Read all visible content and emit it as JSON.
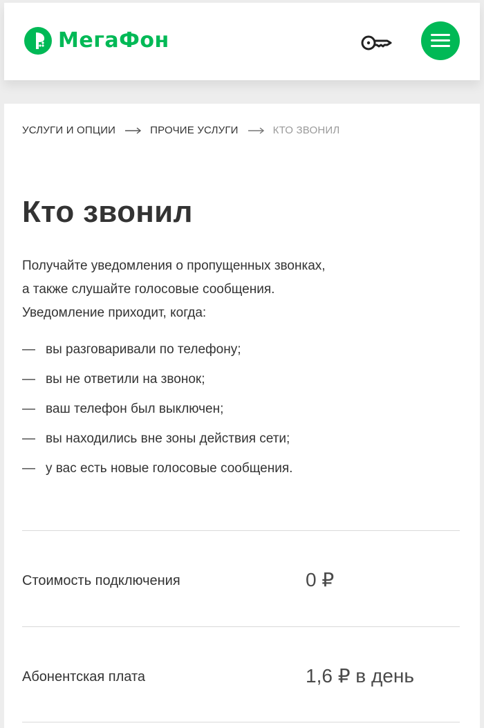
{
  "brand": {
    "name": "МегаФон",
    "color": "#00b956"
  },
  "header": {
    "login_icon": "key-icon",
    "menu_icon": "hamburger-menu-icon"
  },
  "breadcrumb": [
    {
      "label": "Услуги и опции"
    },
    {
      "label": "Прочие услуги"
    },
    {
      "label": "Кто звонил"
    }
  ],
  "page": {
    "title": "Кто звонил",
    "intro_line1": "Получайте уведомления о пропущенных звонках,",
    "intro_line2": "а также слушайте голосовые сообщения.",
    "intro_line3": "Уведомление приходит, когда:",
    "conditions": [
      "вы разговаривали по телефону;",
      "вы не ответили на звонок;",
      "ваш телефон был выключен;",
      "вы находились вне зоны действия сети;",
      "у вас есть новые голосовые сообщения."
    ],
    "dash": "—"
  },
  "pricing": [
    {
      "label": "Стоимость подключения",
      "value": "0 ₽"
    },
    {
      "label": "Абонентская плата",
      "value": "1,6 ₽ в день"
    }
  ]
}
